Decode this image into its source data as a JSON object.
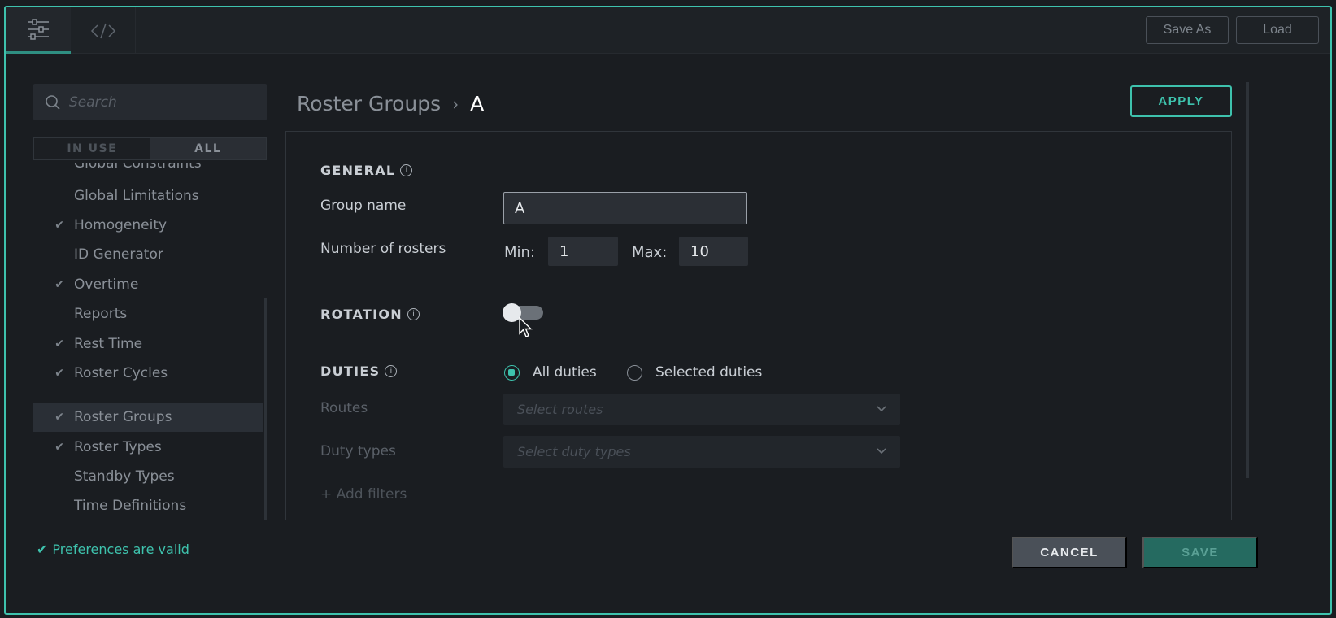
{
  "toolbar": {
    "tabs": [
      {
        "icon": "sliders-icon",
        "active": true
      },
      {
        "icon": "code-icon",
        "active": false
      }
    ],
    "save_as_label": "Save As",
    "load_label": "Load"
  },
  "sidebar": {
    "search_placeholder": "Search",
    "filter": {
      "in_use_label": "IN USE",
      "all_label": "ALL",
      "selected": "ALL"
    },
    "items": [
      {
        "label": "Global Constraints",
        "checked": false
      },
      {
        "label": "Global Limitations",
        "checked": false
      },
      {
        "label": "Homogeneity",
        "checked": true
      },
      {
        "label": "ID Generator",
        "checked": false
      },
      {
        "label": "Overtime",
        "checked": true
      },
      {
        "label": "Reports",
        "checked": false
      },
      {
        "label": "Rest Time",
        "checked": true
      },
      {
        "label": "Roster Cycles",
        "checked": true
      },
      {
        "label": "Roster Groups",
        "checked": true,
        "active": true
      },
      {
        "label": "Roster Types",
        "checked": true
      },
      {
        "label": "Standby Types",
        "checked": false
      },
      {
        "label": "Time Definitions",
        "checked": false
      }
    ]
  },
  "main": {
    "breadcrumb": {
      "parent": "Roster Groups",
      "separator": "›",
      "current": "A"
    },
    "apply_label": "APPLY",
    "general": {
      "title": "GENERAL",
      "group_name_label": "Group name",
      "group_name_value": "A",
      "number_of_rosters_label": "Number of rosters",
      "min_label": "Min:",
      "min_value": "1",
      "max_label": "Max:",
      "max_value": "10"
    },
    "rotation": {
      "title": "ROTATION",
      "enabled": false
    },
    "duties": {
      "title": "DUTIES",
      "options": [
        "All duties",
        "Selected duties"
      ],
      "selected": "All duties",
      "routes_label": "Routes",
      "routes_placeholder": "Select routes",
      "duty_types_label": "Duty types",
      "duty_types_placeholder": "Select duty types",
      "add_filters_label": "+ Add filters"
    }
  },
  "footer": {
    "status_text": "Preferences are valid",
    "cancel_label": "CANCEL",
    "save_label": "SAVE"
  },
  "colors": {
    "accent": "#3ec2ad",
    "background": "#1a1d21",
    "save_button": "#256a60",
    "cancel_button": "#4a5058"
  }
}
